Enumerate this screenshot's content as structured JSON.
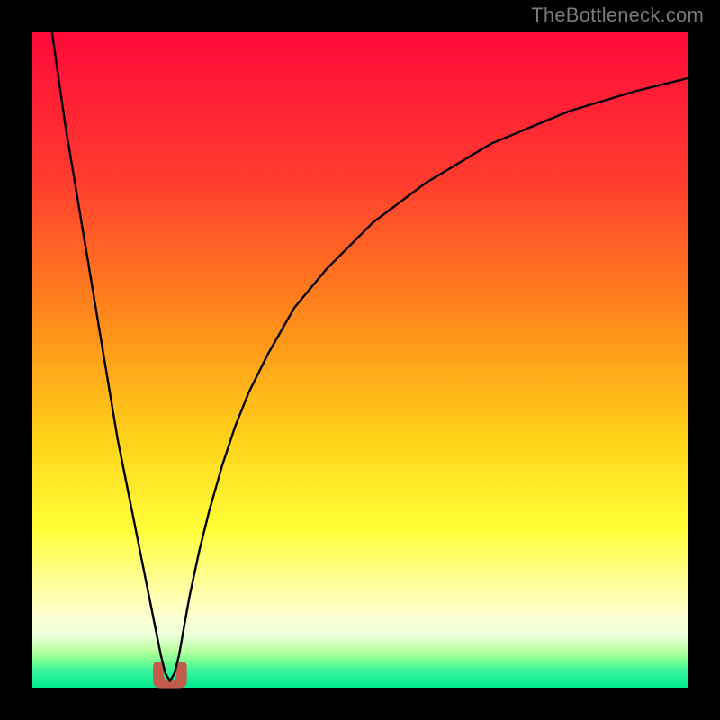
{
  "watermark": "TheBottleneck.com",
  "chart_data": {
    "type": "line",
    "title": "",
    "xlabel": "",
    "ylabel": "",
    "xlim": [
      0,
      100
    ],
    "ylim": [
      0,
      100
    ],
    "grid": false,
    "legend": false,
    "gradient_stops": [
      {
        "offset": 0,
        "color": "#ff0a3a"
      },
      {
        "offset": 22,
        "color": "#ff3a2f"
      },
      {
        "offset": 45,
        "color": "#ff8f1a"
      },
      {
        "offset": 62,
        "color": "#ffd21a"
      },
      {
        "offset": 76,
        "color": "#ffff3a"
      },
      {
        "offset": 84,
        "color": "#ffff9a"
      },
      {
        "offset": 89,
        "color": "#ffffd0"
      },
      {
        "offset": 92,
        "color": "#ecffdc"
      },
      {
        "offset": 94.5,
        "color": "#b6ff9e"
      },
      {
        "offset": 96,
        "color": "#74ff90"
      },
      {
        "offset": 97.5,
        "color": "#34f59a"
      },
      {
        "offset": 100,
        "color": "#00e98f"
      }
    ],
    "marker": {
      "x": 21,
      "width": 5,
      "color": "#c15b4b"
    },
    "series": [
      {
        "name": "curve",
        "color": "#000000",
        "x": [
          3,
          4,
          5,
          6,
          7,
          8,
          9,
          10,
          11,
          12,
          13,
          14,
          15,
          16,
          17,
          18,
          18.8,
          19.6,
          20.3,
          21.0,
          21.7,
          22.4,
          23.1,
          24,
          25.5,
          27,
          29,
          31,
          33,
          36,
          40,
          45,
          52,
          60,
          70,
          82,
          92,
          100
        ],
        "y": [
          100,
          93,
          86,
          80,
          74,
          68,
          62,
          56,
          50,
          44,
          38,
          33,
          28,
          23,
          18,
          13,
          9.0,
          5.0,
          2.2,
          1.0,
          2.2,
          5.0,
          9.0,
          14,
          21,
          27,
          34,
          40,
          45,
          51,
          58,
          64,
          71,
          77,
          83,
          88,
          91,
          93
        ]
      }
    ]
  }
}
